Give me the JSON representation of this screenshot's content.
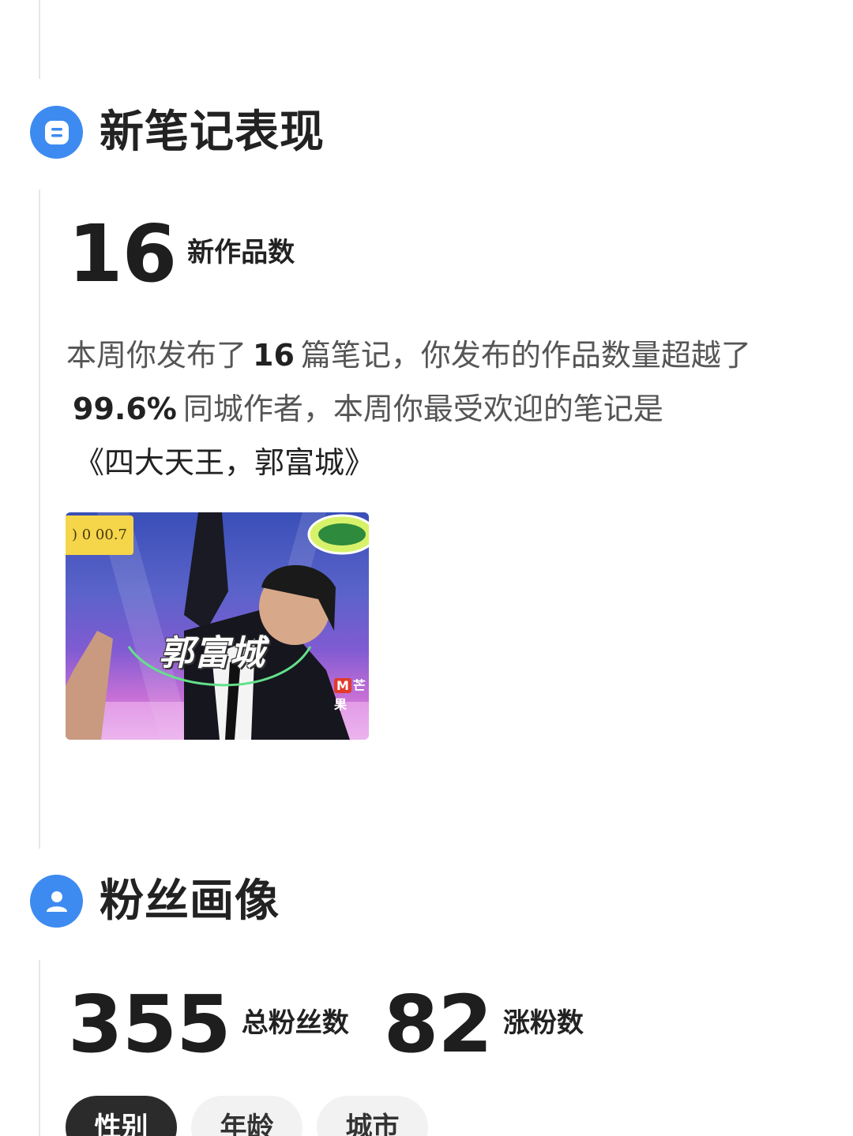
{
  "sections": {
    "new_notes": {
      "title": "新笔记表现",
      "icon": "document-icon"
    },
    "fans": {
      "title": "粉丝画像",
      "icon": "user-icon"
    }
  },
  "new_notes_stat": {
    "value": "16",
    "label": "新作品数"
  },
  "summary": {
    "part1": "本周你发布了",
    "count": "16",
    "part2": "篇笔记，你发布的作品数量超越了",
    "percent": "99.6%",
    "part3": "同城作者，本周你最受欢迎的笔记是",
    "note_title": "《四大天王，郭富城》"
  },
  "thumbnail": {
    "badge_text": ") 0 00.7",
    "caption": "郭富城",
    "logo_mark": "M",
    "logo_text": "芒果"
  },
  "fans_stats": {
    "total_value": "355",
    "total_label": "总粉丝数",
    "growth_value": "82",
    "growth_label": "涨粉数"
  },
  "tabs": [
    {
      "label": "性别",
      "active": true
    },
    {
      "label": "年龄",
      "active": false
    },
    {
      "label": "城市",
      "active": false
    }
  ],
  "colors": {
    "accent": "#3d8bf0",
    "active_tab": "#2b2b2b",
    "inactive_tab": "#f2f2f2"
  }
}
